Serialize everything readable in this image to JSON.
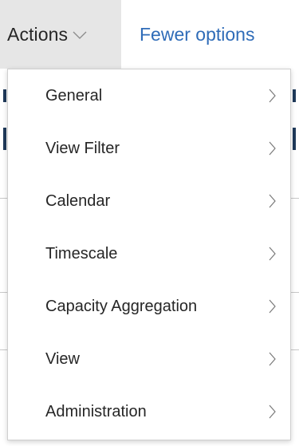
{
  "toolbar": {
    "actions_label": "Actions",
    "fewer_options_label": "Fewer options"
  },
  "menu": {
    "items": [
      {
        "label": "General"
      },
      {
        "label": "View Filter"
      },
      {
        "label": "Calendar"
      },
      {
        "label": "Timescale"
      },
      {
        "label": "Capacity Aggregation"
      },
      {
        "label": "View"
      },
      {
        "label": "Administration"
      }
    ]
  },
  "colors": {
    "actions_bg": "#e6e6e6",
    "link": "#2f6cb8",
    "text": "#262626",
    "menu_border": "#cfcfcf"
  },
  "icons": {
    "actions_dropdown": "chevron-down-icon",
    "submenu": "chevron-right-icon"
  }
}
